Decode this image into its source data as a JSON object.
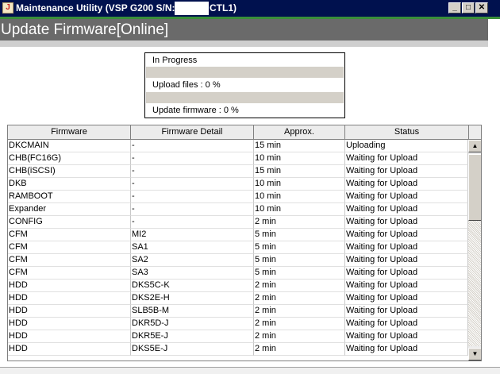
{
  "window": {
    "title_prefix": "Maintenance Utility (VSP G200 S/N:",
    "title_suffix": "CTL1)",
    "app_icon_glyph": "J",
    "buttons": {
      "minimize": "_",
      "restore": "□",
      "close": "✕"
    }
  },
  "header": {
    "title": "Update Firmware[Online]"
  },
  "progress": {
    "status": "In Progress",
    "upload_label": "Upload files : 0 %",
    "upload_percent": 0,
    "firmware_label": "Update firmware : 0 %",
    "firmware_percent": 0
  },
  "table": {
    "columns": [
      "Firmware",
      "Firmware Detail",
      "Approx.",
      "Status"
    ],
    "rows": [
      [
        "DKCMAIN",
        "-",
        "15 min",
        "Uploading"
      ],
      [
        "CHB(FC16G)",
        "-",
        "10 min",
        "Waiting for Upload"
      ],
      [
        "CHB(iSCSI)",
        "-",
        "15 min",
        "Waiting for Upload"
      ],
      [
        "DKB",
        "-",
        "10 min",
        "Waiting for Upload"
      ],
      [
        "RAMBOOT",
        "-",
        "10 min",
        "Waiting for Upload"
      ],
      [
        "Expander",
        "-",
        "10 min",
        "Waiting for Upload"
      ],
      [
        "CONFIG",
        "-",
        "2 min",
        "Waiting for Upload"
      ],
      [
        "CFM",
        "MI2",
        "5 min",
        "Waiting for Upload"
      ],
      [
        "CFM",
        "SA1",
        "5 min",
        "Waiting for Upload"
      ],
      [
        "CFM",
        "SA2",
        "5 min",
        "Waiting for Upload"
      ],
      [
        "CFM",
        "SA3",
        "5 min",
        "Waiting for Upload"
      ],
      [
        "HDD",
        "DKS5C-K",
        "2 min",
        "Waiting for Upload"
      ],
      [
        "HDD",
        "DKS2E-H",
        "2 min",
        "Waiting for Upload"
      ],
      [
        "HDD",
        "SLB5B-M",
        "2 min",
        "Waiting for Upload"
      ],
      [
        "HDD",
        "DKR5D-J",
        "2 min",
        "Waiting for Upload"
      ],
      [
        "HDD",
        "DKR5E-J",
        "2 min",
        "Waiting for Upload"
      ],
      [
        "HDD",
        "DKS5E-J",
        "2 min",
        "Waiting for Upload"
      ]
    ]
  },
  "scrollbar": {
    "up": "▲",
    "down": "▼"
  }
}
